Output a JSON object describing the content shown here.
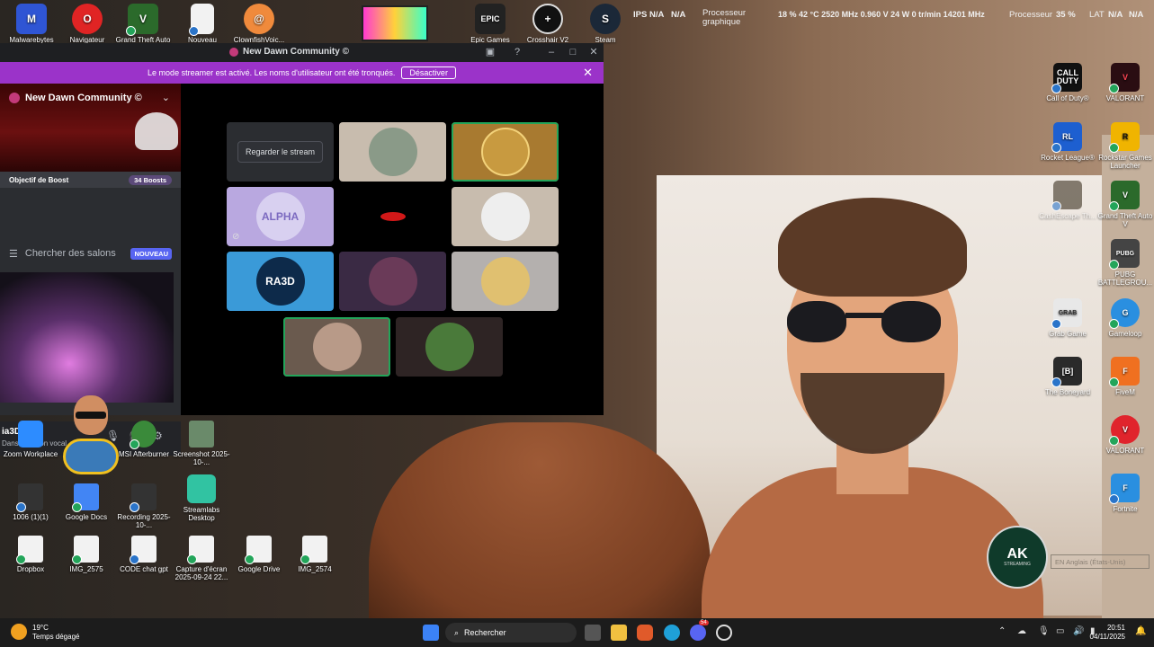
{
  "desktop_top_icons": [
    {
      "label": "Malwarebytes",
      "color": "#2f55d4",
      "glyph": "M"
    },
    {
      "label": "Navigateur",
      "color": "#e02424",
      "glyph": "O"
    },
    {
      "label": "Grand Theft Auto",
      "color": "#2b6a2b",
      "glyph": "V"
    },
    {
      "label": "Nouveau",
      "color": "#f2f2f2",
      "glyph": ""
    },
    {
      "label": "ClownfishVoic...",
      "color": "#f08a3c",
      "glyph": "@"
    },
    {
      "label": "Epic Games",
      "color": "#222",
      "glyph": "EPIC"
    },
    {
      "label": "Crosshair V2",
      "color": "#111",
      "glyph": "+"
    },
    {
      "label": "Steam",
      "color": "#1b2838",
      "glyph": "S"
    }
  ],
  "hud": {
    "ips_label": "IPS",
    "ips_v1": "N/A",
    "ips_v2": "N/A",
    "gpu_label_1": "Processeur",
    "gpu_label_2": "graphique",
    "gpu_stats": "18 %  42 °C  2520 MHz  0.960 V  24 W  0 tr/min  14201 MHz",
    "cpu_label": "Processeur",
    "cpu_value": "35 %",
    "lat_label": "LAT",
    "lat_v1": "N/A",
    "lat_v2": "N/A"
  },
  "window": {
    "title": "New Dawn Community ©",
    "banner_text": "Le mode streamer est activé. Les noms d'utilisateur ont été tronqués.",
    "banner_button": "Désactiver",
    "close_glyph": "✕"
  },
  "sidebar": {
    "server_name": "New Dawn Community ©",
    "boost_label": "Objectif de Boost",
    "boost_count": "34 Boosts",
    "search_label": "Chercher des salons",
    "new_badge": "NOUVEAU",
    "user_name": "ia3D",
    "user_status": "Dans un salon vocal"
  },
  "tiles": {
    "watch_label": "Regarder le stream",
    "alpha": "ALPHA",
    "ra3d": "RA3D"
  },
  "desktop_lower_icons": [
    {
      "label": "Zoom Workplace"
    },
    {
      "label": "MSI Afterburner"
    },
    {
      "label": "Screenshot 2025-10-..."
    },
    {
      "label": "1006 (1)(1)"
    },
    {
      "label": "Google Docs"
    },
    {
      "label": "Recording 2025-10-..."
    },
    {
      "label": "Streamlabs Desktop"
    },
    {
      "label": "Dropbox"
    },
    {
      "label": "IMG_2575"
    },
    {
      "label": "CODE chat gpt"
    },
    {
      "label": "Capture d'écran 2025-09-24 22..."
    },
    {
      "label": "Google Drive"
    },
    {
      "label": "IMG_2574"
    }
  ],
  "desktop_right_icons": [
    {
      "label": "Call of Duty®",
      "color": "#111",
      "glyph": "CALL DUTY"
    },
    {
      "label": "VALORANT",
      "color": "#2a0d12",
      "glyph": "V"
    },
    {
      "label": "Rocket League®",
      "color": "#1d5fd0",
      "glyph": "RL"
    },
    {
      "label": "Rockstar Games Launcher",
      "color": "#f0b400",
      "glyph": "R"
    },
    {
      "label": "CashEscape Th...",
      "color": "#3a3020",
      "glyph": ""
    },
    {
      "label": "Grand Theft Auto V",
      "color": "#2b6a2b",
      "glyph": "V"
    },
    {
      "label": "PUBG BATTLEGROU...",
      "color": "#444",
      "glyph": "PUBG"
    },
    {
      "label": "Grab Game",
      "color": "#e8e8e8",
      "glyph": "GRAB"
    },
    {
      "label": "Gameloop",
      "color": "#2a8fe0",
      "glyph": "G"
    },
    {
      "label": "The Boneyard",
      "color": "#2a2a2a",
      "glyph": "[B]"
    },
    {
      "label": "FiveM",
      "color": "#f07020",
      "glyph": "F"
    },
    {
      "label": "VALORANT",
      "color": "#e0242c",
      "glyph": "V"
    },
    {
      "label": "Fortnite",
      "color": "#2a8fe0",
      "glyph": "F"
    }
  ],
  "overlay": {
    "ak_text": "AK",
    "ak_sub": "STREAMING",
    "lang_text": "EN Anglais (États-Unis)"
  },
  "taskbar": {
    "temp": "19°C",
    "weather": "Temps dégagé",
    "search": "Rechercher",
    "time": "20:51",
    "date": "04/11/2025",
    "discord_badge": "54"
  }
}
